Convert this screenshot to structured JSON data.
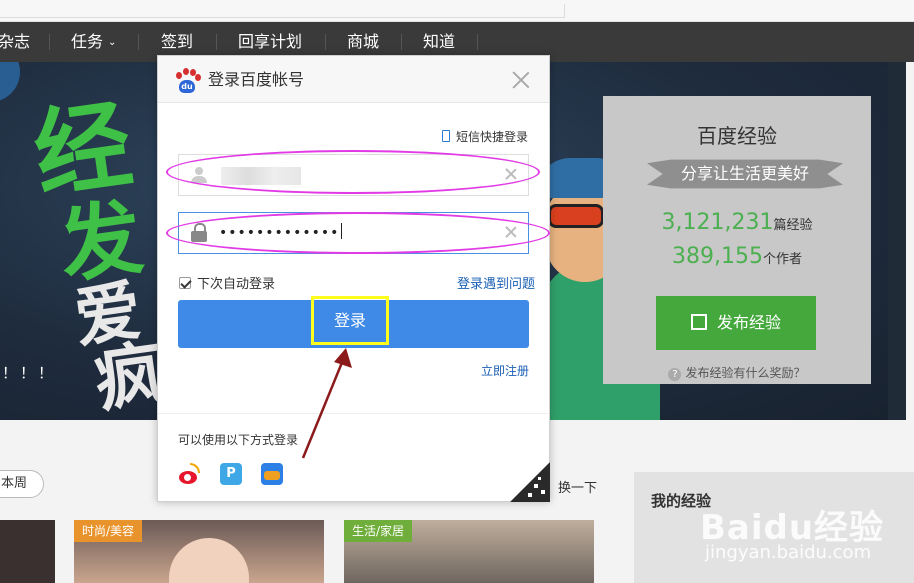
{
  "nav": {
    "items": [
      "杂志",
      "任务",
      "签到",
      "回享计划",
      "商城",
      "知道"
    ]
  },
  "hero": {
    "big_chars": [
      "经",
      "发",
      "爱",
      "疯"
    ],
    "exclam": "！！！"
  },
  "stat_card": {
    "title": "百度经验",
    "slogan": "分享让生活更美好",
    "experiences_count": "3,121,231",
    "experiences_unit": "篇经验",
    "authors_count": "389,155",
    "authors_unit": "个作者",
    "publish_label": "发布经验",
    "reward_link": "发布经验有什么奖励？"
  },
  "modal": {
    "title": "登录百度帐号",
    "logo_text": "du",
    "sms_link": "短信快捷登录",
    "password_value": "•••••••••••••",
    "remember_label": "下次自动登录",
    "problem_link": "登录遇到问题",
    "login_label": "登录",
    "register_link": "立即注册",
    "other_methods": "可以使用以下方式登录",
    "pass_icon_text": "P"
  },
  "lower": {
    "pill_text": "本周",
    "change_label": "换一下",
    "thumb_tags": [
      "时尚/美容",
      "生活/家居"
    ],
    "my_experience": "我的经验"
  },
  "watermark": {
    "logo": "Baidu经验",
    "url": "jingyan.baidu.com"
  },
  "colors": {
    "accent": "#3f8ae6",
    "green": "#44a83c",
    "highlight_oval": "#e23be6",
    "highlight_box": "#ffff1e",
    "arrow": "#8b1a1a"
  }
}
